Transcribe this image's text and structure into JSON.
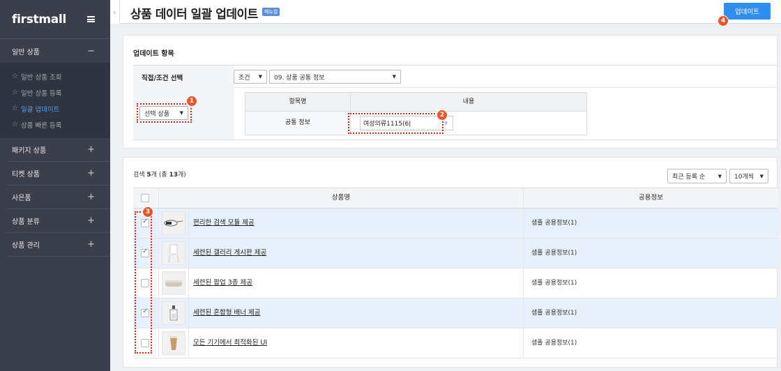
{
  "sidebar": {
    "logo": "firstmall",
    "groups": [
      {
        "label": "일반 상품",
        "sign": "−"
      },
      {
        "label": "패키지 상품",
        "sign": "+"
      },
      {
        "label": "티켓 상품",
        "sign": "+"
      },
      {
        "label": "사은품",
        "sign": "+"
      },
      {
        "label": "상품 분류",
        "sign": "+"
      },
      {
        "label": "상품 관리",
        "sign": "+"
      }
    ],
    "submenu": [
      {
        "label": "일반 상품 조회",
        "active": false
      },
      {
        "label": "일반 상품 등록",
        "active": false
      },
      {
        "label": "일괄 업데이트",
        "active": true
      },
      {
        "label": "상품 빠른 등록",
        "active": false
      }
    ]
  },
  "header": {
    "title": "상품 데이터 일괄 업데이트",
    "badge": "매뉴얼",
    "update_label": "업데이트"
  },
  "update_section": {
    "title": "업데이트 항목",
    "direct_label": "직접/조건 선택",
    "condition_select": "조건",
    "category_select": "09. 상품 공통 정보",
    "target_select": "선택 상품",
    "table": {
      "col_item": "항목명",
      "col_content": "내용",
      "row_label": "공통 정보",
      "row_value": "여성의류1115(6|"
    }
  },
  "list_section": {
    "count_prefix": "검색 ",
    "count_bold": "5",
    "count_mid": "개 (총 ",
    "count_total": "13",
    "count_suffix": "개)",
    "sort_select": "최근 등록 순",
    "page_size_select": "10개씩",
    "col_name": "상품명",
    "col_info": "공용정보",
    "rows": [
      {
        "name": "편리한 검색 모듈 제공",
        "info": "샘플 공용정보(1)",
        "checked": true
      },
      {
        "name": "세련된 갤러리 게시판 제공",
        "info": "샘플 공용정보(1)",
        "checked": true
      },
      {
        "name": "세련된 팝업 3종 제공",
        "info": "샘플 공용정보(1)",
        "checked": false
      },
      {
        "name": "세련된 혼합형 배너 제공",
        "info": "샘플 공용정보(1)",
        "checked": true
      },
      {
        "name": "모든 기기에서 최적화된 UI",
        "info": "샘플 공용정보(1)",
        "checked": false
      }
    ]
  },
  "markers": [
    "1",
    "2",
    "3",
    "4"
  ],
  "colors": {
    "sidebar_bg": "#3a3f4b",
    "accent": "#2f8ef0",
    "marker": "#e8572b",
    "selected_row": "#e8f1fb"
  }
}
